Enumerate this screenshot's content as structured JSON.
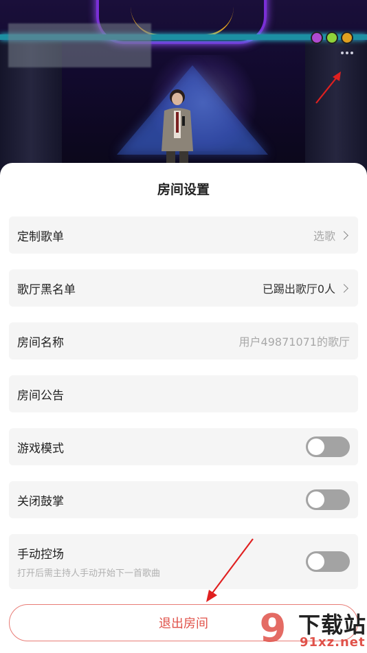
{
  "sheet": {
    "title": "房间设置",
    "rows": [
      {
        "label": "定制歌单",
        "value": "选歌"
      },
      {
        "label": "歌厅黑名单",
        "value": "已踢出歌厅0人"
      },
      {
        "label": "房间名称",
        "value": "用户49871071的歌厅"
      },
      {
        "label": "房间公告",
        "value": ""
      },
      {
        "label": "游戏模式",
        "toggle": false
      },
      {
        "label": "关闭鼓掌",
        "toggle": false
      },
      {
        "label": "手动控场",
        "sublabel": "打开后需主持人手动开始下一首歌曲",
        "toggle": false
      }
    ],
    "exit_label": "退出房间"
  },
  "stage": {
    "indicator_colors": [
      "#b04ad0",
      "#8fd23a",
      "#e0a020"
    ]
  },
  "watermark": {
    "logo_text": "9",
    "title": "下载站",
    "url": "91xz.net"
  },
  "colors": {
    "accent": "#e0524a",
    "toggle_off": "#a3a3a3",
    "row_bg": "#f5f5f5"
  },
  "icons": [
    "more-icon",
    "chevron-right-icon",
    "arrow-annotation-icon"
  ]
}
